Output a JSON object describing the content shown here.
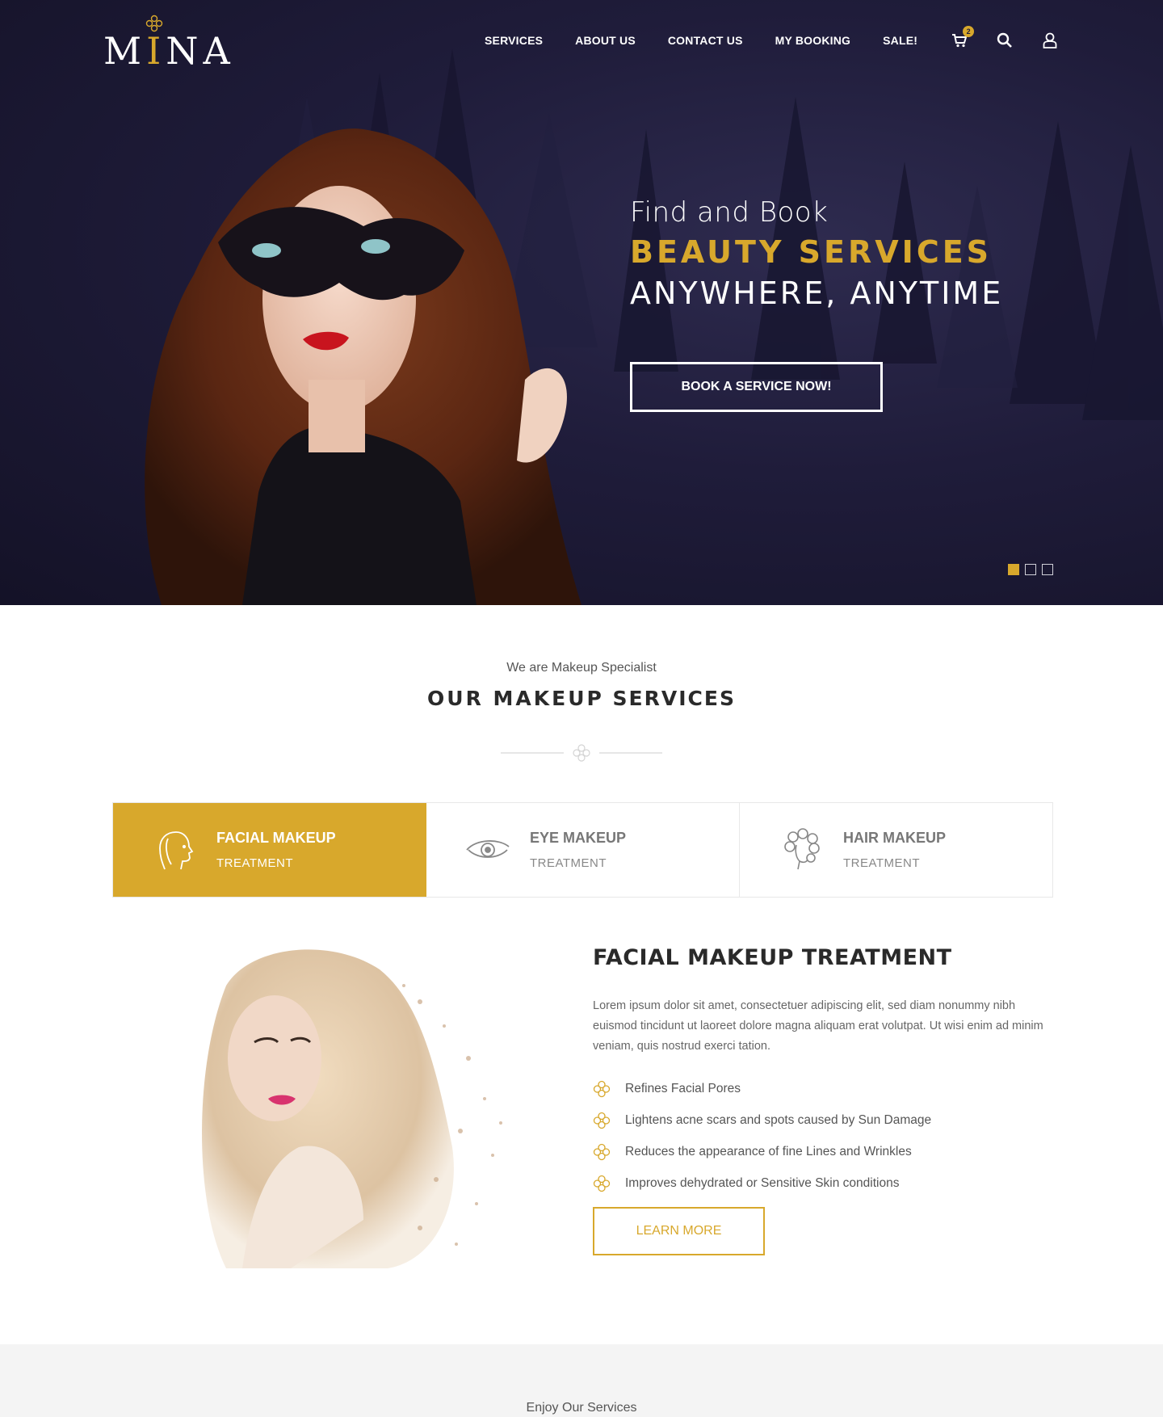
{
  "brand": {
    "logo_text_1": "M",
    "logo_text_2": "I",
    "logo_text_3": "NA"
  },
  "nav": {
    "items": [
      "SERVICES",
      "ABOUT US",
      "CONTACT US",
      "MY BOOKING",
      "SALE!"
    ],
    "cart_count": "2",
    "icons": [
      "cart-icon",
      "search-icon",
      "user-icon"
    ]
  },
  "hero": {
    "line1": "Find and Book",
    "line2": "BEAUTY SERVICES",
    "line3": "ANYWHERE, ANYTIME",
    "cta": "BOOK A SERVICE NOW!",
    "slides": 3,
    "active_slide": 1
  },
  "services": {
    "subtitle": "We are Makeup Specialist",
    "title_bold": "OUR MAKEUP",
    "title_rest": " SERVICES",
    "tabs": [
      {
        "title": "FACIAL MAKEUP",
        "sub": "TREATMENT",
        "icon": "face-icon",
        "active": true
      },
      {
        "title": "EYE MAKEUP",
        "sub": "TREATMENT",
        "icon": "eye-icon",
        "active": false
      },
      {
        "title": "HAIR MAKEUP",
        "sub": "TREATMENT",
        "icon": "hair-icon",
        "active": false
      }
    ]
  },
  "feature": {
    "title": "FACIAL MAKEUP TREATMENT",
    "description": "Lorem ipsum dolor sit amet, consectetuer adipiscing elit, sed diam nonummy nibh euismod tincidunt ut laoreet dolore magna aliquam erat volutpat. Ut wisi enim ad minim veniam, quis nostrud exerci tation.",
    "list": [
      "Refines Facial Pores",
      "Lightens acne scars and spots caused by Sun Damage",
      "Reduces the appearance of fine Lines and Wrinkles",
      "Improves dehydrated or Sensitive Skin conditions"
    ],
    "button": "LEARN MORE"
  },
  "next_section": {
    "subtitle": "Enjoy Our Services"
  },
  "colors": {
    "accent": "#d8a82c",
    "hero_bg": "#1f1c3a",
    "text_dark": "#2a2a2a"
  }
}
